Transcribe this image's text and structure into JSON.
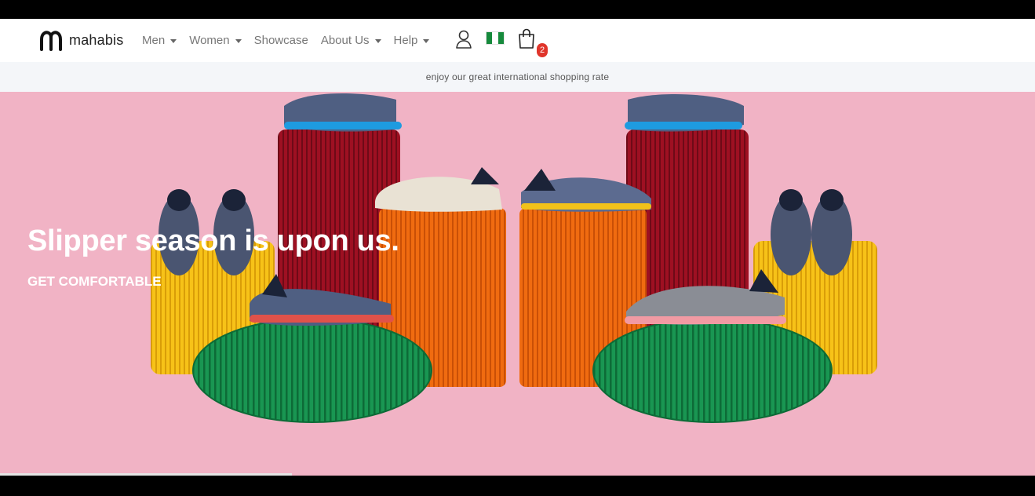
{
  "brand": {
    "name": "mahabis",
    "accent": "#e0352b"
  },
  "nav": {
    "items": [
      {
        "label": "Men",
        "dropdown": true
      },
      {
        "label": "Women",
        "dropdown": true
      },
      {
        "label": "Showcase",
        "dropdown": false
      },
      {
        "label": "About Us",
        "dropdown": true
      },
      {
        "label": "Help",
        "dropdown": true
      }
    ],
    "icons": [
      "user-icon",
      "nigeria-flag-icon",
      "shopping-bag-icon"
    ],
    "cart_count": "2"
  },
  "promo": {
    "text": "enjoy our great international shopping rate"
  },
  "hero": {
    "title": "Slipper season is upon us.",
    "cta": "GET COMFORTABLE",
    "background": "#f1b3c5"
  }
}
